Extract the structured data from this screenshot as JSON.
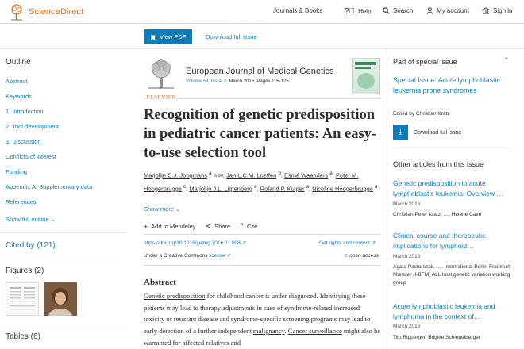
{
  "header": {
    "brand": "ScienceDirect",
    "nav": {
      "journals": "Journals & Books",
      "help": "Help",
      "search": "Search",
      "account": "My account",
      "signin": "Sign in"
    }
  },
  "toolbar": {
    "view_pdf": "View PDF",
    "download_issue": "Download full issue"
  },
  "outline": {
    "title": "Outline",
    "items": [
      "Abstract",
      "Keywords",
      "1. Introduction",
      "2. Tool development",
      "3. Discussion",
      "Conflicts of interest",
      "Funding",
      "Appendix A. Supplementary data",
      "References"
    ],
    "show_full": "Show full outline"
  },
  "cited_by": "Cited by (121)",
  "figures": "Figures (2)",
  "tables": "Tables (6)",
  "journal": {
    "publisher": "ELSEVIER",
    "name": "European Journal of Medical Genetics",
    "volume_link": "Volume 59, Issue 3",
    "meta_rest": ", March 2016, Pages 116-125"
  },
  "article": {
    "title": "Recognition of genetic predisposition in pediatric cancer patients: An easy-to-use selection tool",
    "authors": [
      {
        "name": "Marjolijn C.J. Jongmans",
        "sup": "a"
      },
      {
        "name": "Jan L.C.M. Loeffen",
        "sup": "b"
      },
      {
        "name": "Esmé Waanders",
        "sup": "a"
      },
      {
        "name": "Peter M. Hoogerbrugge",
        "sup": "c"
      },
      {
        "name": "Marjolijn J.L. Ligtenberg",
        "sup": "a"
      },
      {
        "name": "Roland P. Kuiper",
        "sup": "a"
      },
      {
        "name": "Nicoline Hoogerbrugge",
        "sup": "a"
      }
    ],
    "show_more": "Show more",
    "actions": {
      "mendeley": "Add to Mendeley",
      "share": "Share",
      "cite": "Cite"
    },
    "doi": "https://doi.org/10.1016/j.ejmg.2016.01.008",
    "rights": "Get rights and content",
    "license_prefix": "Under a Creative Commons ",
    "license_link": "license",
    "open_access": "open access",
    "abstract_title": "Abstract",
    "abstract": {
      "p1": "Genetic predisposition",
      "p2": " for childhood cancer is under diagnosed. Identifying these patients may lead to therapy adjustments in case of syndrome-related increased toxicity or resistant disease and syndrome-specific screening programs may lead to early detection of a further independent ",
      "p3": "malignancy",
      "p4": ". ",
      "p5": "Cancer surveillance",
      "p6": " might also be warranted for affected relatives and"
    }
  },
  "special_issue": {
    "header": "Part of special issue",
    "title": "Special Issue: Acute lymphoblastic leukemia prone syndromes",
    "editor": "Edited by Christian Kratz",
    "download": "Download full issue"
  },
  "other_articles": {
    "header": "Other articles from this issue",
    "items": [
      {
        "title": "Genetic predisposition to acute lymphoblastic leukemia: Overview …",
        "date": "March 2016",
        "authors": "Christian Peter Kratz, …, Hélène Cavé"
      },
      {
        "title": "Clinical course and therapeutic implications for lymphoid…",
        "date": "March 2016",
        "authors": "Agata Pastorczak, …, International Berlin-Frankfurt-Munster (I-BFM) ALL host genetic variation working group"
      },
      {
        "title": "Acute lymphoblastic leukemia and lymphoma in the context of…",
        "date": "March 2016",
        "authors": "Tim Ripperger, Brigitte Schlegelberger"
      }
    ]
  },
  "colors": {
    "brand": "#e9711c",
    "link": "#0c7dbb",
    "button": "#0c7dbb"
  }
}
